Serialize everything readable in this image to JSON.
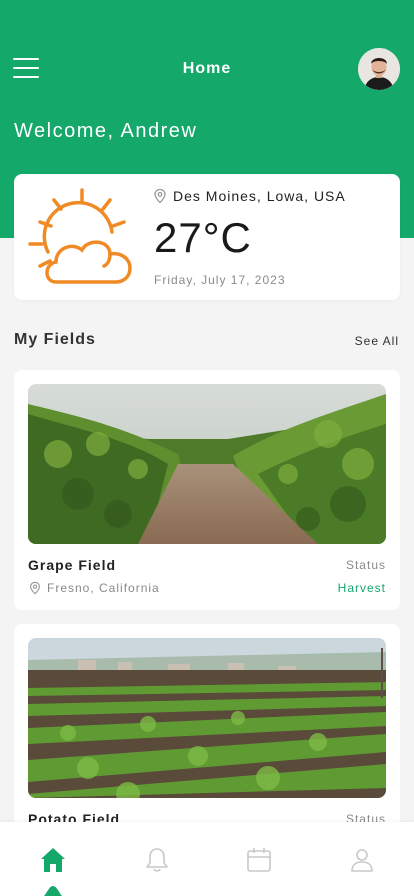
{
  "header": {
    "title": "Home",
    "welcome": "Welcome, Andrew",
    "background_color": "#14a86a"
  },
  "weather": {
    "location": "Des Moines, Lowa, USA",
    "temperature": "27°C",
    "date": "Friday, July 17, 2023",
    "icon": "partly-sunny-icon"
  },
  "fields_section": {
    "title": "My Fields",
    "see_all": "See All"
  },
  "fields": [
    {
      "name": "Grape Field",
      "status_label": "Status",
      "location": "Fresno, California",
      "status": "Harvest"
    },
    {
      "name": "Potato Field",
      "status_label": "Status",
      "location": "",
      "status": ""
    }
  ],
  "nav": {
    "items": [
      "home-icon",
      "bell-icon",
      "calendar-icon",
      "user-icon"
    ],
    "active": "home-icon",
    "active_color": "#14a86a",
    "inactive_color": "#c8c8c8"
  }
}
